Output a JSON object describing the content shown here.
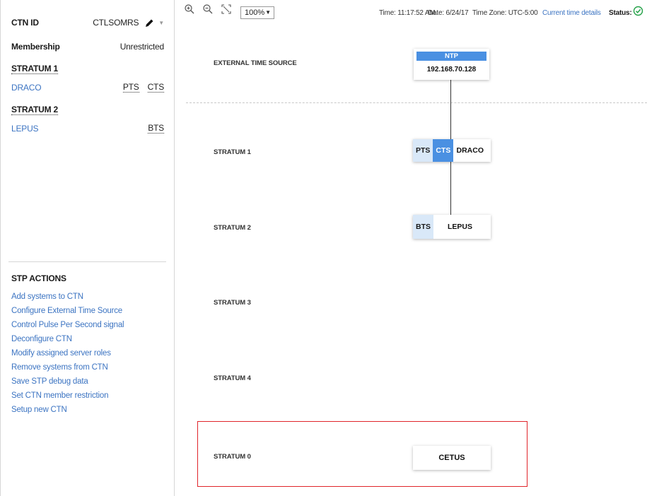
{
  "left_panel": {
    "ctn_id_label": "CTN ID",
    "ctn_id_value": "CTLSOMRS",
    "membership_label": "Membership",
    "membership_value": "Unrestricted",
    "strata": [
      {
        "title": "STRATUM 1",
        "system": "DRACO",
        "roles": [
          "PTS",
          "CTS"
        ]
      },
      {
        "title": "STRATUM 2",
        "system": "LEPUS",
        "roles": [
          "BTS"
        ]
      }
    ],
    "actions_title": "STP ACTIONS",
    "actions": [
      "Add systems to CTN",
      "Configure External Time Source",
      "Control Pulse Per Second signal",
      "Deconfigure CTN",
      "Modify assigned server roles",
      "Remove systems from CTN",
      "Save STP debug data",
      "Set CTN member restriction",
      "Setup new CTN"
    ]
  },
  "toolbar": {
    "icons": [
      "zoom-in-icon",
      "zoom-out-icon",
      "fit-to-screen-icon"
    ],
    "zoom_value": "100%",
    "time": "Time: 11:17:52 AM",
    "date": "Date: 6/24/17",
    "time_zone": "Time Zone: UTC-5:00",
    "details_link": "Current time details",
    "status_label": "Status:",
    "status_icon": "check-circle-icon",
    "status_color": "#24a148"
  },
  "topology": {
    "bands": {
      "external": "EXTERNAL TIME SOURCE",
      "stratum1": "STRATUM 1",
      "stratum2": "STRATUM 2",
      "stratum3": "STRATUM 3",
      "stratum4": "STRATUM 4",
      "stratum0": "STRATUM 0"
    },
    "ntp_node": {
      "header": "NTP",
      "address": "192.168.70.128"
    },
    "draco_node": {
      "roles": [
        "PTS",
        "CTS"
      ],
      "active_role": "CTS",
      "name": "DRACO"
    },
    "lepus_node": {
      "roles": [
        "BTS"
      ],
      "name": "LEPUS"
    },
    "cetus_node": {
      "name": "CETUS"
    },
    "colors": {
      "accent": "#4a90e2",
      "role_light": "#d9e8f8",
      "highlight": "#e0242a",
      "link": "#3c74c2"
    }
  }
}
